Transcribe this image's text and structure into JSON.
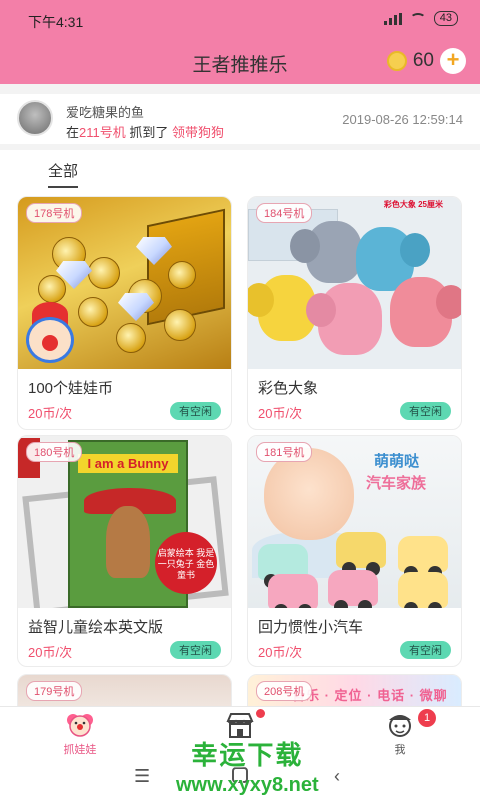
{
  "status_bar": {
    "time": "下午4:31",
    "battery": "43"
  },
  "header": {
    "title": "王者推推乐",
    "coins": "60",
    "add_label": "+"
  },
  "notice": {
    "user": "爱吃糖果的鱼",
    "prefix": "在",
    "machine": "211号机",
    "middle": " 抓到了 ",
    "prize": "领带狗狗",
    "time": "2019-08-26 12:59:14"
  },
  "filter": {
    "active_tab": "全部"
  },
  "cards": [
    {
      "tag": "178号机",
      "name": "100个娃娃币",
      "price": "20币/次",
      "status": "有空闲"
    },
    {
      "tag": "184号机",
      "name": "彩色大象",
      "price": "20币/次",
      "status": "有空闲",
      "img_label": "彩色大象  25厘米"
    },
    {
      "tag": "180号机",
      "name": "益智儿童绘本英文版",
      "price": "20币/次",
      "status": "有空闲",
      "img_title": "I am a Bunny",
      "img_stamp": "启蒙绘本 我是一只兔子 金色童书"
    },
    {
      "tag": "181号机",
      "name": "回力惯性小汽车",
      "price": "20币/次",
      "status": "有空闲",
      "img_slogan_1": "萌萌哒",
      "img_slogan_2": "汽车家族"
    },
    {
      "tag": "179号机"
    },
    {
      "tag": "208号机",
      "img_slogan": "音乐 · 定位 · 电话 · 微聊"
    }
  ],
  "tabbar": {
    "tabs": [
      {
        "label": "抓娃娃"
      },
      {
        "label": ""
      },
      {
        "label": "我",
        "badge": "1"
      }
    ]
  },
  "watermark": {
    "title": "幸运下载",
    "url": "www.xyxy8.net"
  },
  "colors": {
    "brand_pink": "#f37fa8",
    "accent_red": "#f0506e",
    "status_green": "#5dd8b2"
  }
}
